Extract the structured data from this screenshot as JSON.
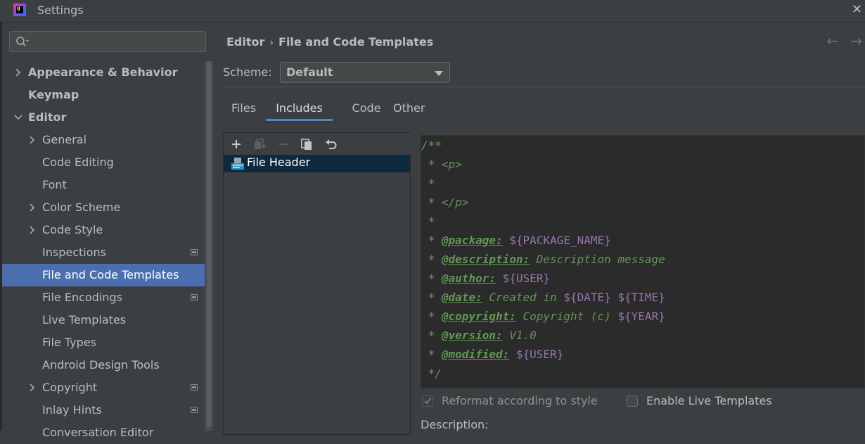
{
  "window": {
    "title": "Settings",
    "app_icon": "intellij-idea-icon",
    "app_icon_text": "IJ",
    "close_glyph": "✕"
  },
  "sidebar": {
    "search": {
      "value": "",
      "placeholder": ""
    },
    "items": [
      {
        "label": "Appearance & Behavior",
        "bold": true,
        "chevron": "right",
        "level": 0
      },
      {
        "label": "Keymap",
        "bold": true,
        "chevron": "none",
        "level": 0
      },
      {
        "label": "Editor",
        "bold": true,
        "chevron": "down",
        "level": 0
      },
      {
        "label": "General",
        "chevron": "right",
        "level": 1
      },
      {
        "label": "Code Editing",
        "chevron": "none",
        "level": 1
      },
      {
        "label": "Font",
        "chevron": "none",
        "level": 1
      },
      {
        "label": "Color Scheme",
        "chevron": "right",
        "level": 1
      },
      {
        "label": "Code Style",
        "chevron": "right",
        "level": 1
      },
      {
        "label": "Inspections",
        "chevron": "none",
        "level": 1,
        "badge": true
      },
      {
        "label": "File and Code Templates",
        "chevron": "none",
        "level": 1,
        "selected": true
      },
      {
        "label": "File Encodings",
        "chevron": "none",
        "level": 1,
        "badge": true
      },
      {
        "label": "Live Templates",
        "chevron": "none",
        "level": 1
      },
      {
        "label": "File Types",
        "chevron": "none",
        "level": 1
      },
      {
        "label": "Android Design Tools",
        "chevron": "none",
        "level": 1
      },
      {
        "label": "Copyright",
        "chevron": "right",
        "level": 1,
        "badge": true
      },
      {
        "label": "Inlay Hints",
        "chevron": "none",
        "level": 1,
        "badge": true
      },
      {
        "label": "Conversation Editor",
        "chevron": "none",
        "level": 1
      }
    ]
  },
  "header": {
    "breadcrumb_parent": "Editor",
    "breadcrumb_sep": "›",
    "breadcrumb_current": "File and Code Templates",
    "back_glyph": "←",
    "forward_glyph": "→"
  },
  "scheme": {
    "label": "Scheme:",
    "value": "Default"
  },
  "tabs": [
    {
      "label": "Files"
    },
    {
      "label": "Includes",
      "active": true
    },
    {
      "label": "Code"
    },
    {
      "label": "Other"
    }
  ],
  "toolbar": {
    "buttons": [
      {
        "name": "add-icon",
        "enabled": true
      },
      {
        "name": "add-child-icon",
        "enabled": false
      },
      {
        "name": "remove-icon",
        "enabled": false
      },
      {
        "name": "copy-icon",
        "enabled": true
      },
      {
        "name": "reset-icon",
        "enabled": true
      }
    ]
  },
  "templates": [
    {
      "label": "File Header",
      "icon": "file-template-icon",
      "selected": true
    }
  ],
  "editor_lines": [
    [
      {
        "t": "/**",
        "c": "txt"
      }
    ],
    [
      {
        "t": " * ",
        "c": "txt"
      },
      {
        "t": "<p>",
        "c": "tag"
      }
    ],
    [
      {
        "t": " *",
        "c": "txt"
      }
    ],
    [
      {
        "t": " * ",
        "c": "txt"
      },
      {
        "t": "</p>",
        "c": "tag"
      }
    ],
    [
      {
        "t": " *",
        "c": "txt"
      }
    ],
    [
      {
        "t": " * ",
        "c": "txt"
      },
      {
        "t": "@package:",
        "c": "kw"
      },
      {
        "t": " ",
        "c": "txt"
      },
      {
        "t": "${PACKAGE_NAME}",
        "c": "var"
      }
    ],
    [
      {
        "t": " * ",
        "c": "txt"
      },
      {
        "t": "@description:",
        "c": "kw"
      },
      {
        "t": " Description message",
        "c": "txt"
      }
    ],
    [
      {
        "t": " * ",
        "c": "txt"
      },
      {
        "t": "@author:",
        "c": "kw"
      },
      {
        "t": " ",
        "c": "txt"
      },
      {
        "t": "${USER}",
        "c": "var"
      }
    ],
    [
      {
        "t": " * ",
        "c": "txt"
      },
      {
        "t": "@date:",
        "c": "kw"
      },
      {
        "t": " Created in ",
        "c": "txt"
      },
      {
        "t": "${DATE}",
        "c": "var"
      },
      {
        "t": " ",
        "c": "txt"
      },
      {
        "t": "${TIME}",
        "c": "var"
      }
    ],
    [
      {
        "t": " * ",
        "c": "txt"
      },
      {
        "t": "@copyright:",
        "c": "kw"
      },
      {
        "t": " Copyright (c) ",
        "c": "txt"
      },
      {
        "t": "${YEAR}",
        "c": "var"
      }
    ],
    [
      {
        "t": " * ",
        "c": "txt"
      },
      {
        "t": "@version:",
        "c": "kw"
      },
      {
        "t": " V1.0",
        "c": "txt"
      }
    ],
    [
      {
        "t": " * ",
        "c": "txt"
      },
      {
        "t": "@modified:",
        "c": "kw"
      },
      {
        "t": " ",
        "c": "txt"
      },
      {
        "t": "${USER}",
        "c": "var"
      }
    ],
    [
      {
        "t": " */",
        "c": "txt"
      }
    ]
  ],
  "options": {
    "reformat": {
      "label": "Reformat according to style",
      "checked": true,
      "enabled": false
    },
    "live_templates": {
      "label": "Enable Live Templates",
      "checked": false,
      "enabled": true
    }
  },
  "description_label": "Description:",
  "colors": {
    "background": "#3c3f41",
    "editor_background": "#2b2b2b",
    "selection": "#4b6eaf",
    "list_selection": "#0d293e",
    "comment_green": "#629755",
    "template_var": "#9876aa",
    "tab_underline": "#4a88c7"
  }
}
